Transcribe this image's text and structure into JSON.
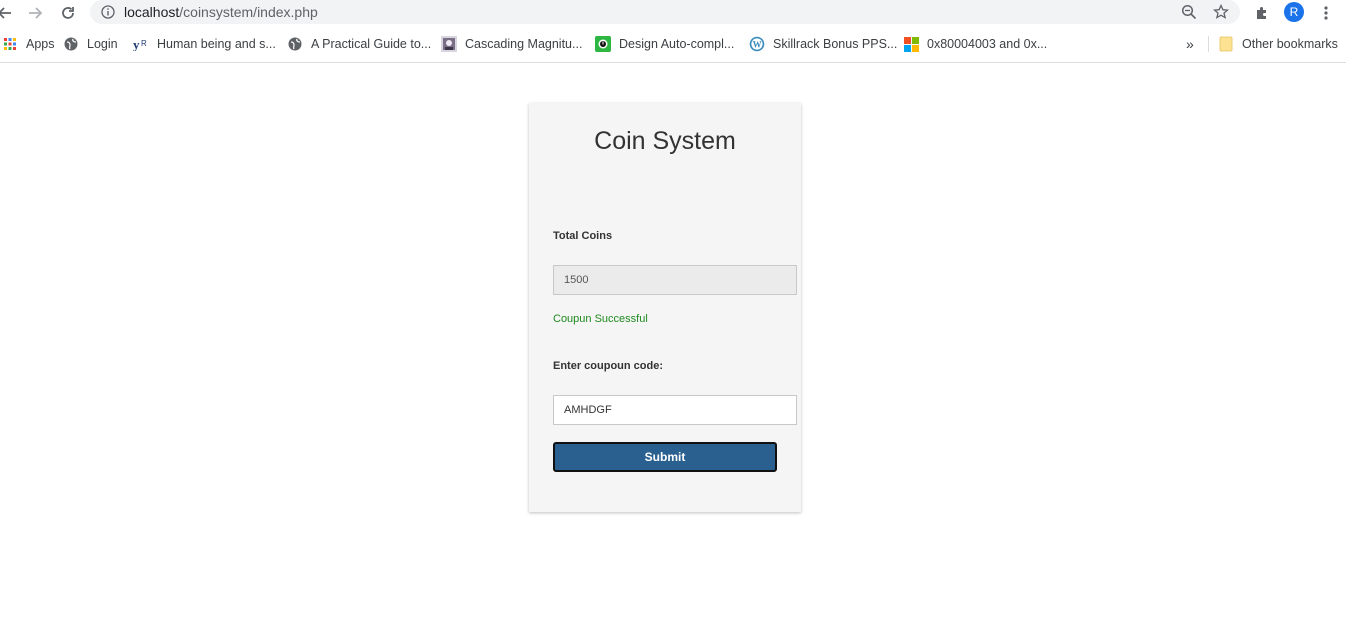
{
  "browser": {
    "url_host": "localhost",
    "url_path": "/coinsystem/index.php",
    "avatar_letter": "R"
  },
  "bookmarks": {
    "items": [
      {
        "label": "Apps",
        "icon": "apps-grid-icon"
      },
      {
        "label": "Login",
        "icon": "globe-icon"
      },
      {
        "label": "Human being and s...",
        "icon": "yr-icon"
      },
      {
        "label": "A Practical Guide to...",
        "icon": "globe-icon"
      },
      {
        "label": "Cascading Magnitu...",
        "icon": "site-image-icon"
      },
      {
        "label": "Design Auto-compl...",
        "icon": "green-clock-icon"
      },
      {
        "label": "Skillrack Bonus PPS...",
        "icon": "wordpress-icon"
      },
      {
        "label": "0x80004003 and 0x...",
        "icon": "microsoft-icon"
      }
    ],
    "overflow": "»",
    "other": "Other bookmarks"
  },
  "card": {
    "title": "Coin System",
    "total_label": "Total Coins",
    "total_value": "1500",
    "status_message": "Coupun Successful",
    "coupon_label": "Enter coupoun code:",
    "coupon_value": "AMHDGF",
    "submit_label": "Submit"
  },
  "colors": {
    "status": "#1e8a1e",
    "submit_bg": "#2a6090",
    "card_bg": "#f5f5f5"
  }
}
